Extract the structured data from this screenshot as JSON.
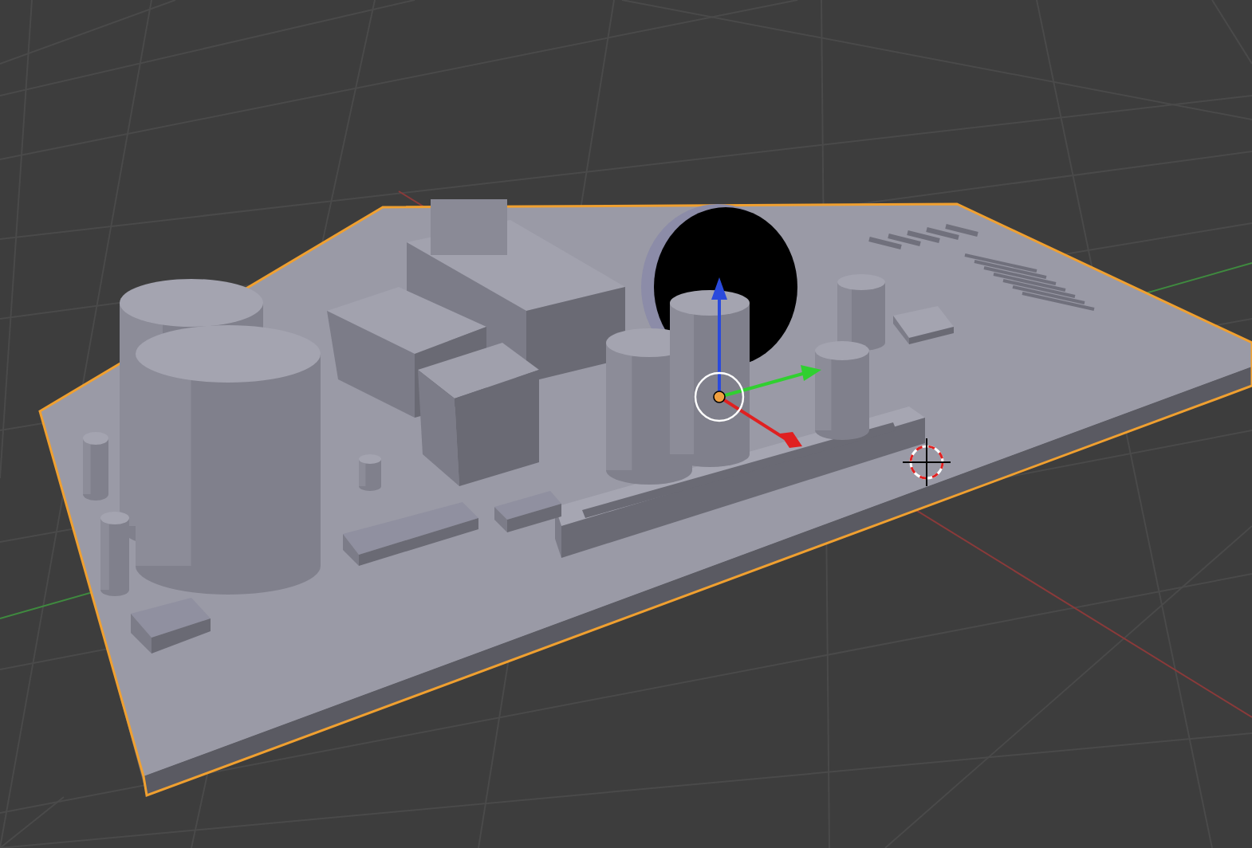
{
  "viewport": {
    "grid": true,
    "selected": true
  }
}
